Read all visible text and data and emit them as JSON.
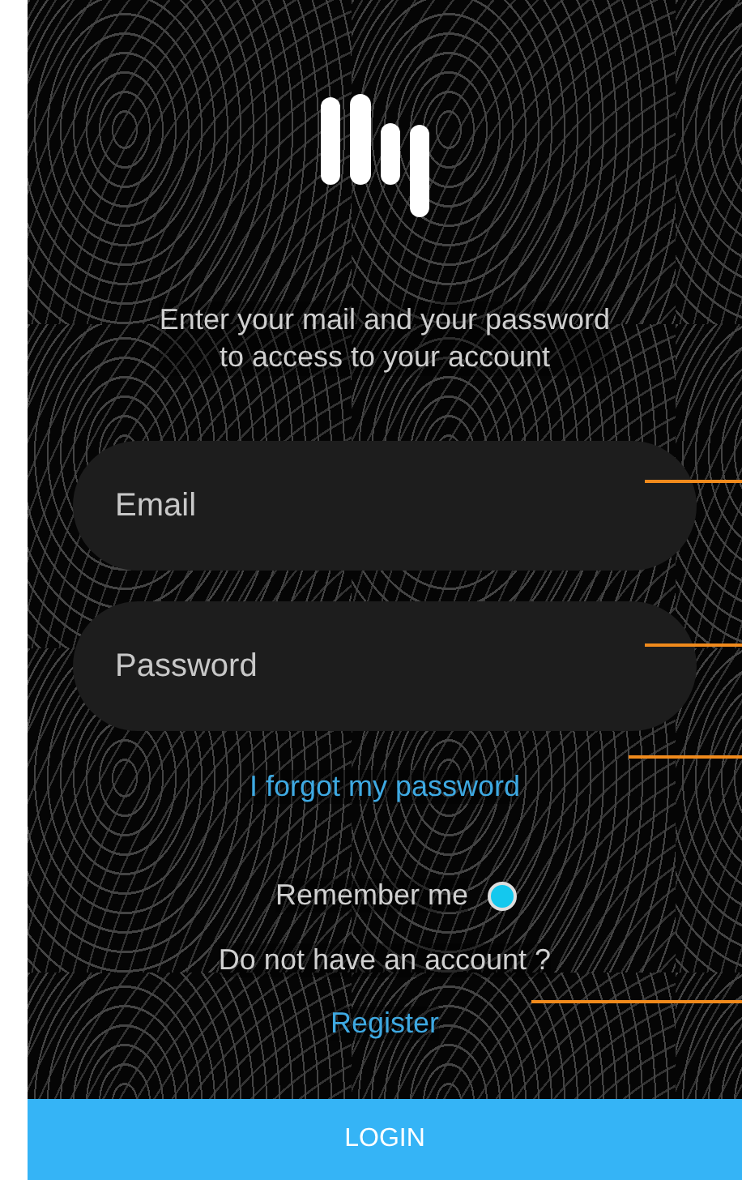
{
  "intro": "Enter your mail and your password\nto access to your account",
  "fields": [
    {
      "placeholder": "Email"
    },
    {
      "placeholder": "Password"
    }
  ],
  "forgot_link": "I forgot my password",
  "remember": {
    "label": "Remember me",
    "selected": true
  },
  "register_prompt": "Do not have an account ?",
  "register_link": "Register",
  "login_button": "LOGIN"
}
